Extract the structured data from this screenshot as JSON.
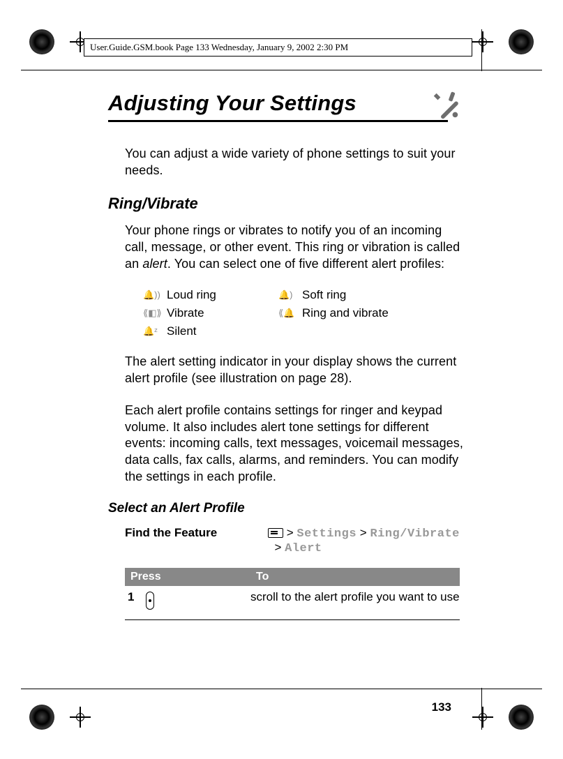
{
  "header": {
    "path_text": "User.Guide.GSM.book  Page 133  Wednesday, January 9, 2002  2:30 PM"
  },
  "title": "Adjusting Your Settings",
  "intro": "You can adjust a wide variety of phone settings to suit your needs.",
  "section_ring": {
    "heading": "Ring/Vibrate",
    "p1_a": "Your phone rings or vibrates to notify you of an incoming call, message, or other event. This ring or vibration is called an ",
    "p1_em": "alert",
    "p1_b": ". You can select one of five different alert profiles:",
    "profiles": {
      "loud": "Loud ring",
      "soft": "Soft ring",
      "vibrate": "Vibrate",
      "ringvib": "Ring and vibrate",
      "silent": "Silent"
    },
    "p2": "The alert setting indicator in your display shows the current alert profile (see illustration on page 28).",
    "p3": "Each alert profile contains settings for ringer and keypad volume. It also includes alert tone settings for different events: incoming calls, text messages, voicemail messages, data calls, fax calls, alarms, and reminders. You can modify the settings in each profile."
  },
  "subsection_select": {
    "heading": "Select an Alert Profile",
    "find_label": "Find the Feature",
    "gt": ">",
    "path": {
      "seg1": "Settings",
      "seg2": "Ring/Vibrate",
      "seg3": "Alert"
    },
    "table": {
      "h1": "Press",
      "h2": "To",
      "row1": {
        "num": "1",
        "desc": "scroll to the alert profile you want to use"
      }
    }
  },
  "page_number": "133"
}
